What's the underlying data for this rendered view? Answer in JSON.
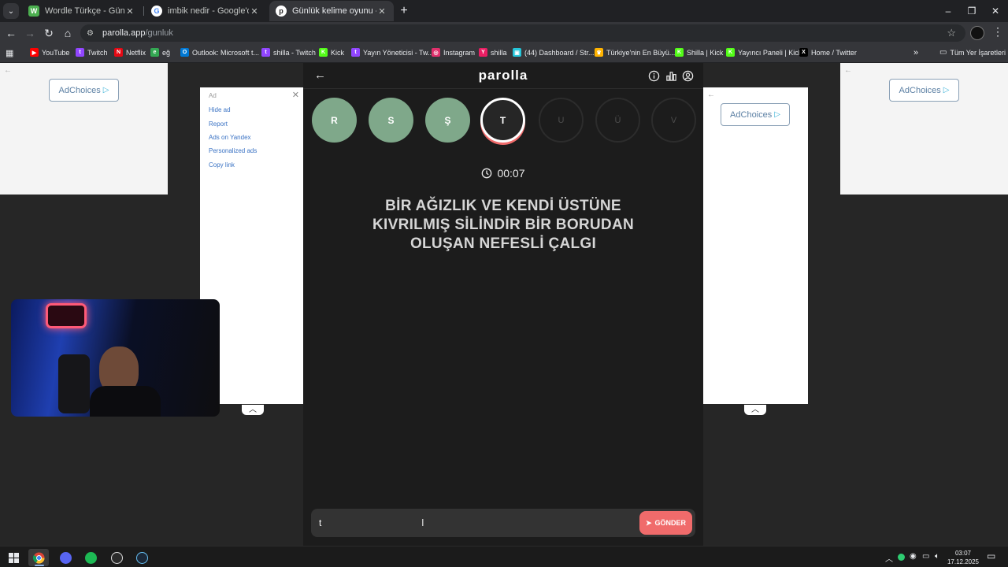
{
  "browser": {
    "tabs": [
      {
        "title": "Wordle Türkçe - Günlük Kelime",
        "favicon": "W",
        "color": "#4caf50"
      },
      {
        "title": "imbik nedir - Google'da Ara",
        "favicon": "G",
        "color": "#ffffff"
      },
      {
        "title": "Günlük kelime oyunu - parolla",
        "favicon": "p",
        "color": "#ffffff"
      }
    ],
    "url_host": "parolla.app",
    "url_path": "/gunluk",
    "bookmarks": [
      {
        "label": "YouTube",
        "icon": "youtube-icon",
        "color": "#ff0000"
      },
      {
        "label": "Twitch",
        "icon": "twitch-icon",
        "color": "#9146ff"
      },
      {
        "label": "Netflix",
        "icon": "netflix-icon",
        "color": "#e50914"
      },
      {
        "label": "eğ",
        "icon": "globe-icon",
        "color": "#34a853"
      },
      {
        "label": "Outlook: Microsoft t...",
        "icon": "outlook-icon",
        "color": "#0078d4"
      },
      {
        "label": "shilla - Twitch",
        "icon": "twitch-icon",
        "color": "#9146ff"
      },
      {
        "label": "Kick",
        "icon": "kick-icon",
        "color": "#53fc18"
      },
      {
        "label": "Yayın Yöneticisi - Tw...",
        "icon": "twitch-icon",
        "color": "#9146ff"
      },
      {
        "label": "Instagram",
        "icon": "instagram-icon",
        "color": "#e1306c"
      },
      {
        "label": "shilla",
        "icon": "y-icon",
        "color": "#e91e63"
      },
      {
        "label": "(44) Dashboard / Str...",
        "icon": "dashboard-icon",
        "color": "#26c6da"
      },
      {
        "label": "Türkiye'nin En Büyü...",
        "icon": "crown-icon",
        "color": "#ffb300"
      },
      {
        "label": "Shilla | Kick",
        "icon": "kick-icon",
        "color": "#53fc18"
      },
      {
        "label": "Yayıncı Paneli | Kick",
        "icon": "kick-icon",
        "color": "#53fc18"
      },
      {
        "label": "Home / Twitter",
        "icon": "x-icon",
        "color": "#000000"
      }
    ],
    "all_bookmarks": "Tüm Yer İşaretleri"
  },
  "ads": {
    "adchoices": "AdChoices",
    "menu_label": "Ad",
    "menu_links": [
      "Hide ad",
      "Report",
      "Ads on Yandex",
      "Personalized ads",
      "Copy link"
    ]
  },
  "game": {
    "brand": "parolla",
    "letters": [
      {
        "char": "R",
        "state": "done"
      },
      {
        "char": "S",
        "state": "done"
      },
      {
        "char": "Ş",
        "state": "done"
      },
      {
        "char": "T",
        "state": "current"
      },
      {
        "char": "U",
        "state": "pending"
      },
      {
        "char": "Ü",
        "state": "pending"
      },
      {
        "char": "V",
        "state": "pending"
      }
    ],
    "timer": "00:07",
    "question_lines": [
      "BİR AĞIZLIK VE KENDİ ÜSTÜNE",
      "KIVRILMIŞ SİLİNDİR BİR BORUDAN",
      "OLUŞAN NEFESLİ ÇALGI"
    ],
    "answer_value": "t",
    "send_label": "GÖNDER",
    "colors": {
      "done": "#7fa88a",
      "accent": "#f06b6b",
      "background": "#1c1c1c"
    }
  },
  "taskbar": {
    "time": "03:07",
    "date": "17.12.2025",
    "apps": [
      "chrome-icon",
      "discord-icon",
      "spotify-icon",
      "obs-icon",
      "steam-icon"
    ]
  }
}
